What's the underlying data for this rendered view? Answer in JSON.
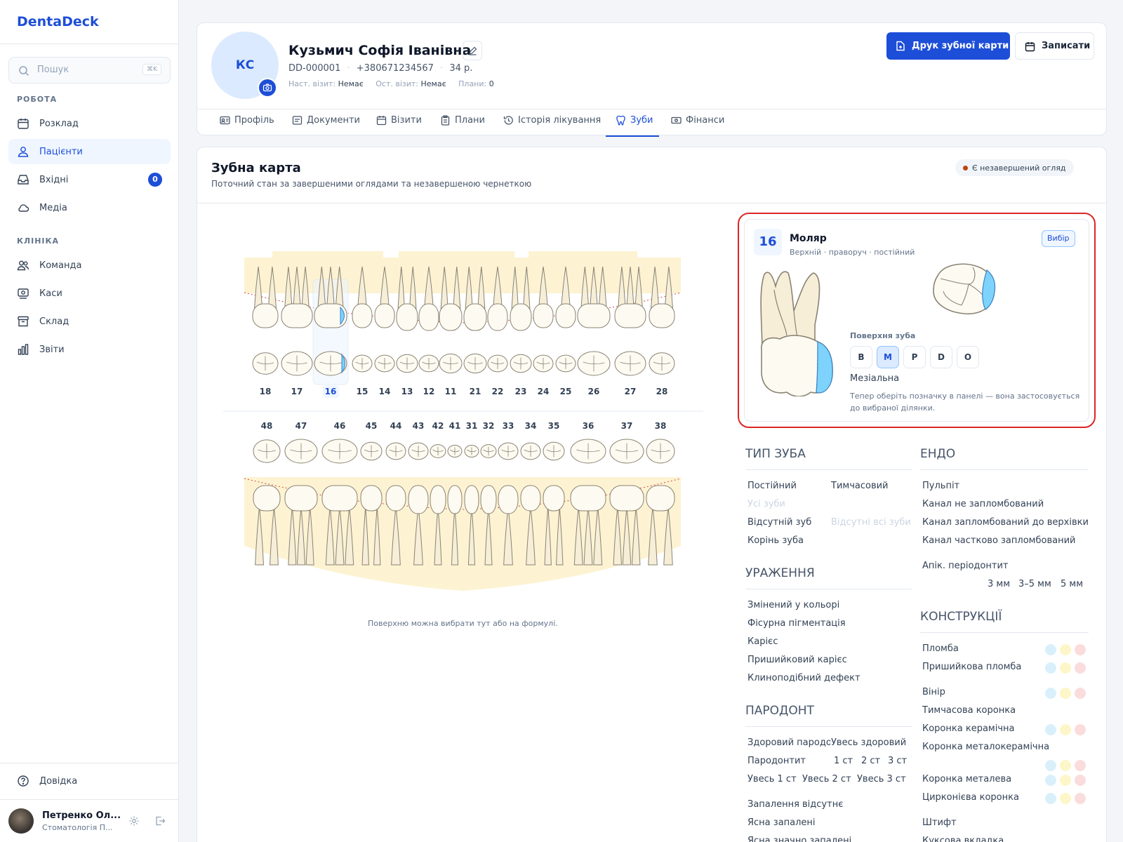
{
  "app": {
    "name": "DentaDeck"
  },
  "sidebar": {
    "search_placeholder": "Пошук",
    "search_shortcut": "⌘K",
    "section_work": "РОБОТА",
    "section_clinic": "КЛІНІКА",
    "items": [
      {
        "label": "Розклад",
        "icon": "calendar-icon"
      },
      {
        "label": "Пацієнти",
        "icon": "users-icon",
        "active": true
      },
      {
        "label": "Вхідні",
        "icon": "inbox-icon",
        "badge": "0"
      },
      {
        "label": "Медіа",
        "icon": "cloud-icon"
      },
      {
        "label": "Команда",
        "icon": "team-icon"
      },
      {
        "label": "Каси",
        "icon": "cash-register-icon"
      },
      {
        "label": "Склад",
        "icon": "archive-icon"
      },
      {
        "label": "Звіти",
        "icon": "bar-chart-icon"
      }
    ],
    "help": "Довідка",
    "user": {
      "name": "Петренко Ол...",
      "role": "Стоматологія П..."
    }
  },
  "patient": {
    "initials": "КС",
    "name": "Кузьмич Софія Іванівна",
    "id": "DD-000001",
    "phone": "+380671234567",
    "age": "34 р.",
    "next_visit_label": "Наст. візит:",
    "next_visit": "Немає",
    "last_visit_label": "Ост. візит:",
    "last_visit": "Немає",
    "plans_label": "Плани:",
    "plans": "0",
    "print_button": "Друк зубної карти",
    "book_button": "Записати"
  },
  "tabs": [
    {
      "label": "Профіль",
      "icon": "profile-card-icon"
    },
    {
      "label": "Документи",
      "icon": "document-icon"
    },
    {
      "label": "Візити",
      "icon": "calendar-icon"
    },
    {
      "label": "Плани",
      "icon": "clipboard-icon"
    },
    {
      "label": "Історія лікування",
      "icon": "history-icon"
    },
    {
      "label": "Зуби",
      "icon": "tooth-icon",
      "active": true
    },
    {
      "label": "Фінанси",
      "icon": "money-icon"
    }
  ],
  "chart_card": {
    "title": "Зубна карта",
    "subtitle": "Поточний стан за завершеними оглядами та незавершеною чернеткою",
    "status": "Є незавершений огляд",
    "status_color": "#c2410c",
    "hint": "Поверхню можна вибрати тут або на формулі."
  },
  "upper_teeth": [
    "18",
    "17",
    "16",
    "15",
    "14",
    "13",
    "12",
    "11",
    "21",
    "22",
    "23",
    "24",
    "25",
    "26",
    "27",
    "28"
  ],
  "lower_teeth": [
    "48",
    "47",
    "46",
    "45",
    "44",
    "43",
    "42",
    "41",
    "31",
    "32",
    "33",
    "34",
    "35",
    "36",
    "37",
    "38"
  ],
  "selected_tooth": "16",
  "tooth_panel": {
    "number": "16",
    "type": "Моляр",
    "description": "Верхній · праворуч · постійний",
    "select_button": "Вибір",
    "surface_label": "Поверхня зуба",
    "surfaces": [
      "B",
      "M",
      "P",
      "D",
      "O"
    ],
    "active_surface": "M",
    "surface_name": "Мезіальна",
    "hint": "Тепер оберіть позначку в панелі — вона застосовується до вибраної ділянки.",
    "highlight_color": "#7dd3fc"
  },
  "palette": {
    "tooth_type": {
      "title": "ТИП ЗУБА",
      "items": [
        "Постійний",
        "Тимчасовий",
        "Усі зуби",
        "Відсутній зуб",
        "Відсутні всі зуби",
        "Корінь зуба"
      ]
    },
    "lesions": {
      "title": "УРАЖЕННЯ",
      "items": [
        "Змінений у кольорі",
        "Фісурна пігментація",
        "Карієс",
        "Пришийковий карієс",
        "Клиноподібний дефект"
      ]
    },
    "periodont": {
      "title": "ПАРОДОНТ",
      "items": [
        "Здоровий пародонт",
        "Увесь здоровий",
        "Пародонтит",
        "1 ст",
        "2 ст",
        "3 ст",
        "Увесь 1 ст",
        "Увесь 2 ст",
        "Увесь 3 ст",
        "Запалення відсутнє",
        "Ясна запалені",
        "Ясна значно запалені"
      ]
    },
    "endo": {
      "title": "ЕНДО",
      "items": [
        "Пульпіт",
        "Канал не запломбований",
        "Канал запломбований до верхівки",
        "Канал частково запломбований",
        "Апік. періодонтит",
        "3 мм",
        "3–5 мм",
        "5 мм"
      ]
    },
    "constructions": {
      "title": "КОНСТРУКЦІЇ",
      "items": [
        "Пломба",
        "Пришийкова пломба",
        "Вінір",
        "Тимчасова коронка",
        "Коронка керамічна",
        "Коронка металокерамічна",
        "Коронка металева",
        "Цирконієва коронка",
        "Штифт",
        "Куксова вкладка"
      ],
      "dot_colors": [
        "#d9f0fb",
        "#fdf6c8",
        "#fbdcdc"
      ]
    }
  }
}
